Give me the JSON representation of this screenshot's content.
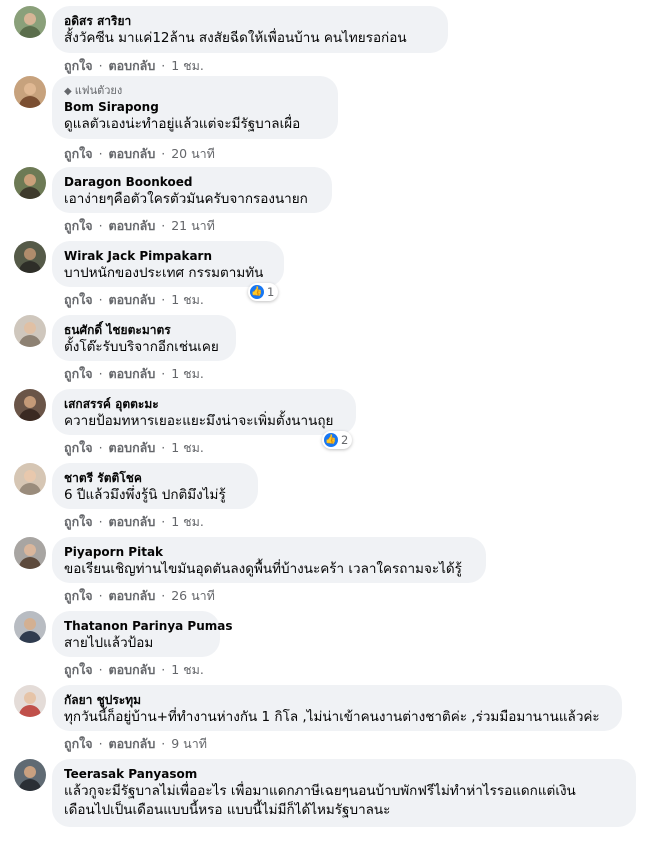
{
  "action_labels": {
    "like": "ถูกใจ",
    "reply": "ตอบกลับ",
    "sep": "·"
  },
  "icons": {
    "like": "like-thumb-icon",
    "badge": "diamond-icon"
  },
  "colors": {
    "bubble": "#f0f2f5",
    "secondary_text": "#65676b",
    "like_blue": "#1877f2"
  },
  "comments": [
    {
      "name": "อดิสร สาริยา",
      "text": "สั้งวัคซีน มาแค่12ล้าน สงสัยฉีดให้เพื่อนบ้าน คนไทยรอก่อน",
      "time": "1 ชม."
    },
    {
      "badge": "แฟนตัวยง",
      "name": "Bom Sirapong",
      "text": "ดูแลตัวเองน่ะทำอยู่แล้วแต่จะมีรัฐบาลเผื่อ",
      "time": "20 นาที"
    },
    {
      "name": "Daragon Boonkoed",
      "text": "เอาง่ายๆคือตัวใครตัวมันครับจากรองนายก",
      "time": "21 นาที"
    },
    {
      "name": "Wirak Jack Pimpakarn",
      "text": "บาปหนักของประเทศ กรรมตามทัน",
      "time": "1 ชม.",
      "reactions": "1"
    },
    {
      "name": "ธนศักดิ์ ไชยตะมาตร",
      "text": "ตั้งโต๊ะรับบริจากอีกเช่นเคย",
      "time": "1 ชม."
    },
    {
      "name": "เสกสรรค์ อุตตะมะ",
      "text": "ควายป้อมทหารเยอะแยะมึงน่าจะเพิ่มตั้งนานถุย",
      "time": "1 ชม.",
      "reactions": "2"
    },
    {
      "name": "ชาตรี รัตติโชค",
      "text": "6 ปีแล้วมึงพึ่งรู้นิ ปกติมึงไม่รู้",
      "time": "1 ชม."
    },
    {
      "name": "Piyaporn Pitak",
      "text": "ขอเรียนเชิญท่านไขมันอุดตันลงดูพื้นที่บ้างนะคร้า เวลาใครถามจะได้รู้",
      "time": "26 นาที"
    },
    {
      "name": "Thatanon Parinya Pumas",
      "text": "สายไปแล้วป้อม",
      "time": "1 ชม."
    },
    {
      "name": "กัลยา ชูประทุม",
      "text": "ทุกวันนี้ก็อยู่บ้าน+ที่ทำงานห่างกัน 1 กิโล ,ไม่น่าเข้าคนงานต่างชาติค่ะ ,ร่วมมือมานานแล้วค่ะ",
      "time": "9 นาที"
    },
    {
      "name": "Teerasak Panyasom",
      "text": "แล้วกูจะมีรัฐบาลไม่เพื่ออะไร เพื่อมาแดกภาษีเฉยๆนอนบ้าบพักฟรีไม่ทำห่าไรรอแดกแต่เงิน",
      "text2": "เดือนไปเป็นเดือนแบบนี้หรอ แบบนี้ไม่มีก็ได้ไหมรัฐบาลนะ"
    }
  ]
}
